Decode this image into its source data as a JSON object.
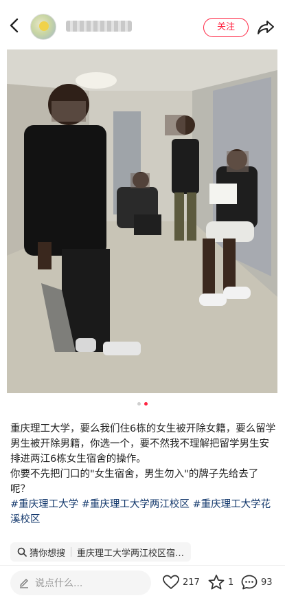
{
  "header": {
    "follow_label": "关注"
  },
  "post": {
    "image_dots": 2,
    "active_dot": 1,
    "body_line1": "重庆理工大学，要么我们住6栋的女生被开除女籍，要么留学男生被开除男籍，你选一个，要不然我不理解把留学男生安排进两江6栋女生宿舍的操作。",
    "body_line2": "你要不先把门口的\"女生宿舍，男生勿入\"的牌子先给去了呢？",
    "tags": "#重庆理工大学 #重庆理工大学两江校区 #重庆理工大学花溪校区"
  },
  "suggest": {
    "label": "猜你想搜",
    "query": "重庆理工大学两江校区宿…"
  },
  "bottom": {
    "comment_placeholder": "说点什么...",
    "likes": "217",
    "favorites": "1",
    "comments": "93"
  },
  "colors": {
    "accent": "#ff2442",
    "tag": "#13386c"
  }
}
